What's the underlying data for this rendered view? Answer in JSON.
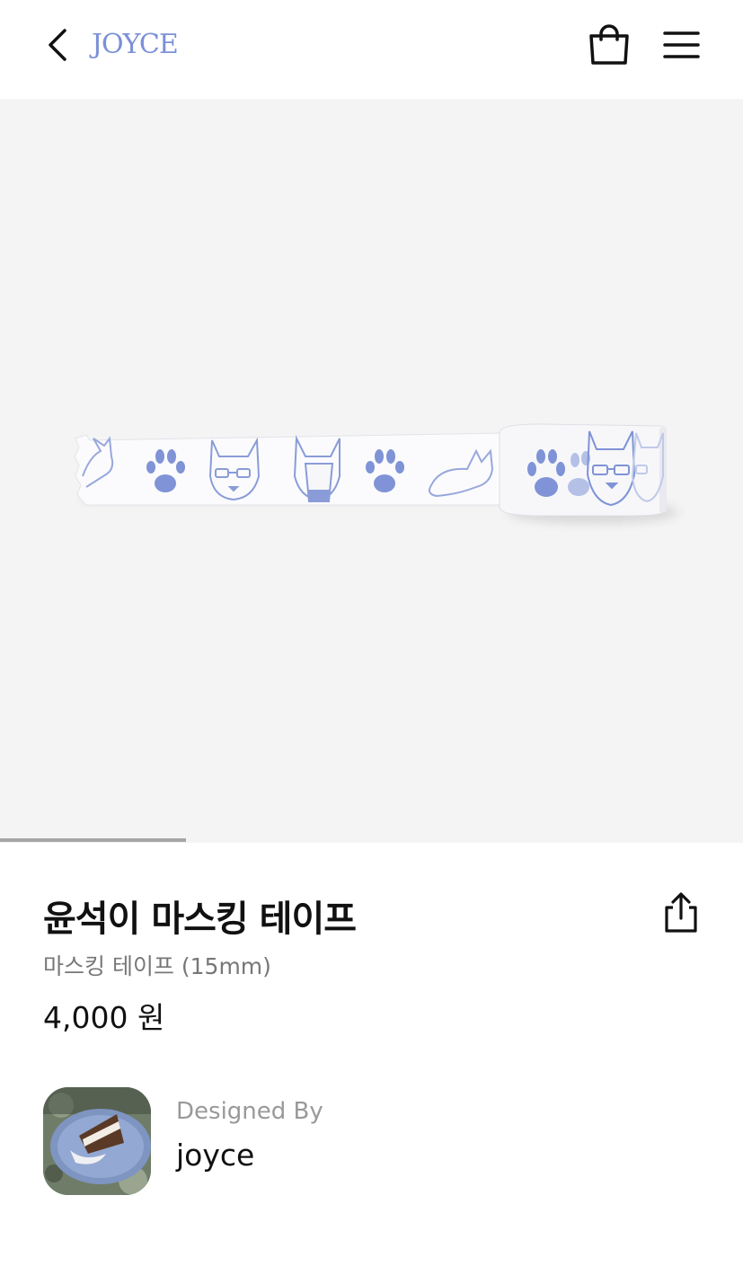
{
  "header": {
    "logo_text": "JOYCE",
    "icons": [
      "chevron-left-icon",
      "shopping-bag-icon",
      "hamburger-menu-icon"
    ],
    "logo_color": "#7b90d6"
  },
  "gallery": {
    "image": "masking-tape-roll-with-dog-and-paw-print-illustrations",
    "background": "#f4f4f4",
    "progress_fraction": 0.25
  },
  "product": {
    "title": "윤석이 마스킹 테이프",
    "subtitle": "마스킹 테이프 (15mm)",
    "price": "4,000 원",
    "share_icon": "share-icon"
  },
  "designer": {
    "label": "Designed By",
    "name": "joyce",
    "avatar": "cake-slice-on-blue-plate-photo"
  }
}
